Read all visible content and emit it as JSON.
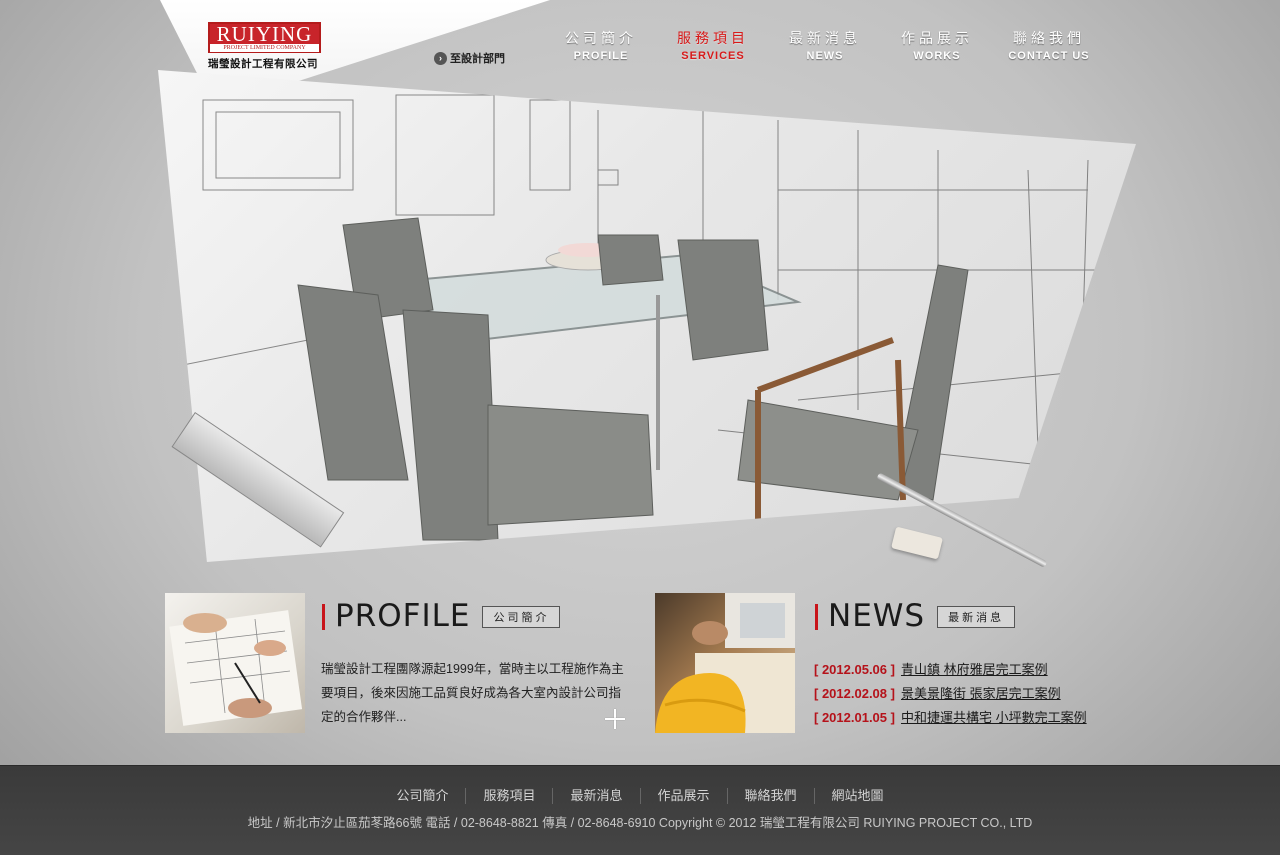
{
  "header": {
    "logo": {
      "mark": "RUIYING",
      "mark_sub": "PROJECT LIMITED COMPANY",
      "name_cn": "瑞瑩設計工程有限公司"
    },
    "design_link": "至設計部門",
    "nav": [
      {
        "cn": "公司簡介",
        "en": "PROFILE"
      },
      {
        "cn": "服務項目",
        "en": "SERVICES",
        "active": true
      },
      {
        "cn": "最新消息",
        "en": "NEWS"
      },
      {
        "cn": "作品展示",
        "en": "WORKS"
      },
      {
        "cn": "聯絡我們",
        "en": "CONTACT US"
      }
    ]
  },
  "profile": {
    "title": "PROFILE",
    "tag": "公司簡介",
    "text": "瑞瑩設計工程團隊源起1999年，當時主以工程施作為主要項目，後來因施工品質良好成為各大室內設計公司指定的合作夥伴..."
  },
  "news": {
    "title": "NEWS",
    "tag": "最新消息",
    "items": [
      {
        "date": "2012.05.06",
        "title": "青山鎮 林府雅居完工案例"
      },
      {
        "date": "2012.02.08",
        "title": "景美景隆街 張家居完工案例"
      },
      {
        "date": "2012.01.05",
        "title": "中和捷運共構宅 小坪數完工案例"
      }
    ]
  },
  "footer": {
    "nav": [
      "公司簡介",
      "服務項目",
      "最新消息",
      "作品展示",
      "聯絡我們",
      "網站地圖"
    ],
    "info": "地址 / 新北市汐止區茄苳路66號 電話 / 02-8648-8821 傳真 / 02-8648-6910   Copyright © 2012 瑞瑩工程有限公司 RUIYING PROJECT CO., LTD"
  },
  "colors": {
    "accent": "#c8141a",
    "footer_bg": "#3f3f3f"
  }
}
